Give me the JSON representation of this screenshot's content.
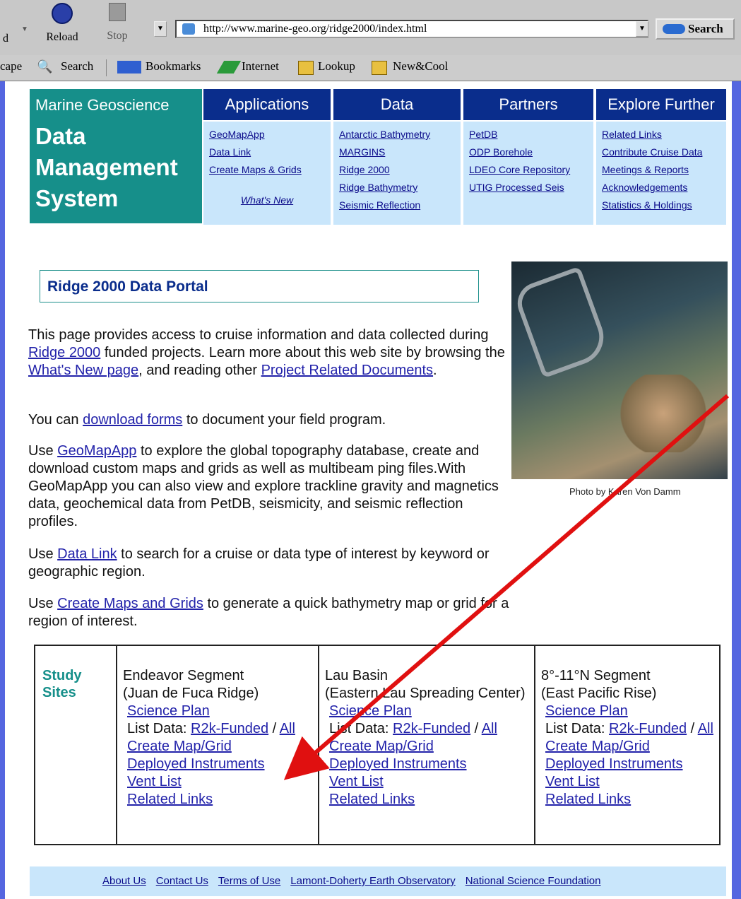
{
  "browser": {
    "back_label": "d",
    "reload_label": "Reload",
    "stop_label": "Stop",
    "url": "http://www.marine-geo.org/ridge2000/index.html",
    "search_label": "Search",
    "personal_toolbar": [
      "cape",
      "Search",
      "Bookmarks",
      "Internet",
      "Lookup",
      "New&Cool"
    ]
  },
  "header": {
    "logo_top": "Marine Geoscience",
    "logo_line1": "Data",
    "logo_line2": "Management",
    "logo_line3": "System"
  },
  "nav": [
    {
      "title": "Applications",
      "links": [
        "GeoMapApp",
        "Data Link",
        "Create Maps & Grids"
      ],
      "extra": "What's New"
    },
    {
      "title": "Data",
      "links": [
        "Antarctic Bathymetry",
        "MARGINS",
        "Ridge 2000",
        "Ridge Bathymetry",
        "Seismic Reflection"
      ]
    },
    {
      "title": "Partners",
      "links": [
        "PetDB",
        "ODP Borehole",
        "LDEO Core Repository",
        "UTIG Processed Seis"
      ]
    },
    {
      "title": "Explore Further",
      "links": [
        "Related Links",
        "Contribute Cruise Data",
        "Meetings & Reports",
        "Acknowledgements",
        "Statistics & Holdings"
      ]
    }
  ],
  "portal_title": "Ridge 2000 Data Portal",
  "photo_caption": "Photo by Karen Von Damm",
  "paragraphs": {
    "p1": [
      "This page provides access to cruise information and data collected during ",
      "Ridge 2000",
      " funded projects. Learn more about this web site by browsing the ",
      "What's New page",
      ", and reading other ",
      "Project Related Documents",
      "."
    ],
    "p2": [
      "You can ",
      "download forms",
      " to document your field program."
    ],
    "p3": [
      "Use ",
      "GeoMapApp",
      " to explore the global topography database, create and download custom maps and grids as well as multibeam ping files.With GeoMapApp you can also view and explore trackline gravity and magnetics data, geochemical data from PetDB, seismicity, and seismic reflection profiles."
    ],
    "p4": [
      "Use ",
      "Data Link",
      " to search for a cruise or data type of interest by keyword or geographic region."
    ],
    "p5": [
      "Use ",
      "Create Maps and Grids",
      " to generate a quick bathymetry map or grid for a region of interest."
    ]
  },
  "study_sites": {
    "label_line1": "Study",
    "label_line2": "Sites",
    "sites": [
      {
        "name1": "Endeavor Segment",
        "name2": "(Juan de Fuca Ridge)",
        "science_plan": "Science Plan",
        "list_prefix": "List Data: ",
        "funded": "R2k-Funded",
        "sep": " / ",
        "all": "All",
        "map": "Create Map/Grid",
        "instruments": "Deployed Instruments",
        "vents": "Vent List",
        "related": "Related Links"
      },
      {
        "name1": "Lau Basin",
        "name2": "(Eastern Lau Spreading Center)",
        "science_plan": "Science Plan",
        "list_prefix": "List Data: ",
        "funded": "R2k-Funded",
        "sep": " / ",
        "all": "All",
        "map": "Create Map/Grid",
        "instruments": "Deployed Instruments",
        "vents": "Vent List",
        "related": "Related Links"
      },
      {
        "name1": "8°-11°N Segment",
        "name2": "(East Pacific Rise)",
        "science_plan": "Science Plan",
        "list_prefix": "List Data: ",
        "funded": "R2k-Funded",
        "sep": " / ",
        "all": "All",
        "map": "Create Map/Grid",
        "instruments": "Deployed Instruments",
        "vents": "Vent List",
        "related": "Related Links"
      }
    ]
  },
  "footer": [
    "About Us",
    "Contact Us",
    "Terms of Use",
    "Lamont-Doherty Earth Observatory",
    "National Science Foundation"
  ],
  "colors": {
    "accent": "#0a2d8c",
    "teal": "#168f8a",
    "nav_bg": "#c9e6fb",
    "annotation": "#e01010"
  }
}
